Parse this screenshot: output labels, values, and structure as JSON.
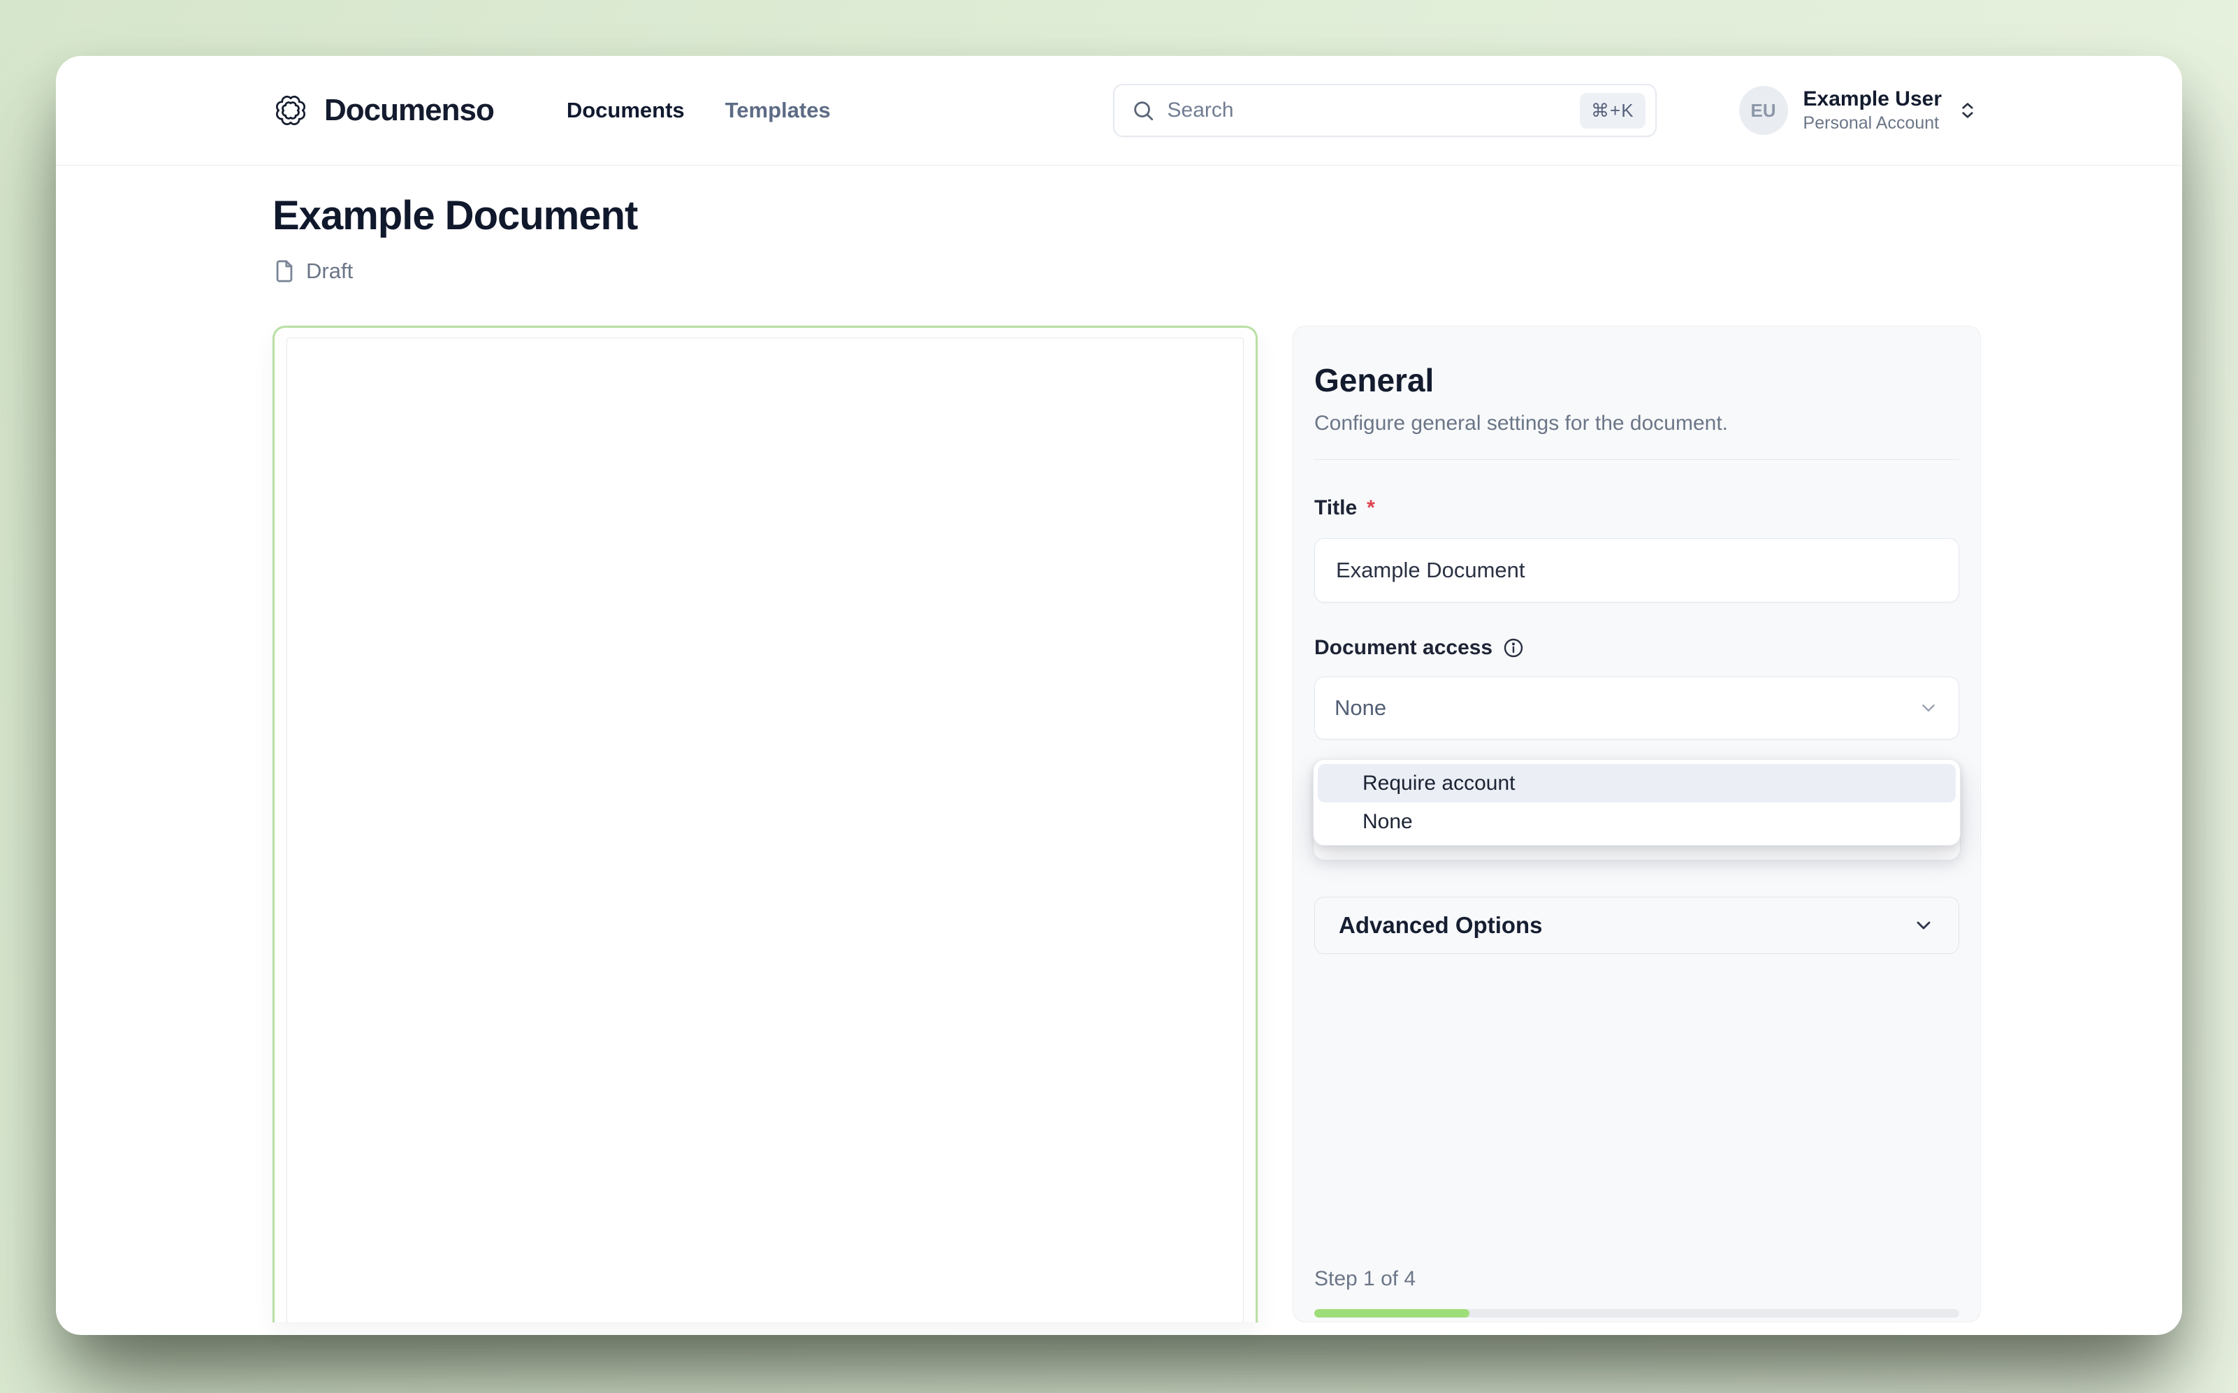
{
  "nav": {
    "brand": "Documenso",
    "links": [
      {
        "label": "Documents",
        "state": "active"
      },
      {
        "label": "Templates",
        "state": "muted"
      }
    ],
    "search": {
      "placeholder": "Search",
      "shortcut": "⌘+K",
      "icon": "search-icon"
    },
    "user": {
      "initials": "EU",
      "name": "Example User",
      "account_type": "Personal Account",
      "icon": "chevrons-up-down-icon"
    }
  },
  "page": {
    "title": "Example Document",
    "status": "Draft",
    "status_icon": "file-icon"
  },
  "panel": {
    "heading": "General",
    "description": "Configure general settings for the document.",
    "title_label": "Title",
    "required_marker": "*",
    "title_value": "Example Document",
    "access_label": "Document access",
    "access_info_icon": "info-icon",
    "access_value": "None",
    "access_options": [
      "Require account",
      "None"
    ],
    "highlighted_option_index": 0,
    "advanced_label": "Advanced Options",
    "step_text": "Step 1 of 4",
    "progress_percent": 24
  },
  "colors": {
    "brand_green": "#a2e771",
    "progress_green": "#9ede79",
    "preview_border_green": "#b9e0a4",
    "option_highlight": "#ebeef5",
    "background_green": "#e0edd7",
    "heading_navy": "#131b2e",
    "muted_slate": "#6b7687",
    "required_red": "#e0434c"
  }
}
